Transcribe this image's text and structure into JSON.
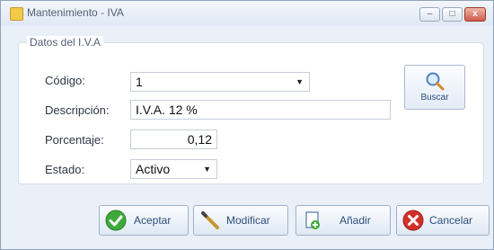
{
  "window": {
    "title": "Mantenimiento - IVA",
    "controls": {
      "minimize": "–",
      "maximize": "□",
      "close": "x"
    }
  },
  "group": {
    "title": "Datos del I.V.A"
  },
  "form": {
    "codigo_label": "Código:",
    "codigo_value": "1",
    "descripcion_label": "Descripción:",
    "descripcion_value": "I.V.A. 12 %",
    "porcentaje_label": "Porcentaje:",
    "porcentaje_value": "0,12",
    "estado_label": "Estado:",
    "estado_value": "Activo"
  },
  "buttons": {
    "buscar": "Buscar",
    "aceptar": "Aceptar",
    "modificar": "Modificar",
    "anadir": "Añadir",
    "cancelar": "Cancelar"
  },
  "icons": {
    "title": "app-icon",
    "buscar": "magnifier-icon",
    "aceptar": "check-icon",
    "modificar": "pencil-icon",
    "anadir": "add-document-icon",
    "cancelar": "cancel-icon"
  },
  "colors": {
    "window_bg": "#eaf0f8",
    "accent_text": "#2e4e7a",
    "accept_green": "#3faa3a",
    "cancel_red": "#d2302b"
  }
}
